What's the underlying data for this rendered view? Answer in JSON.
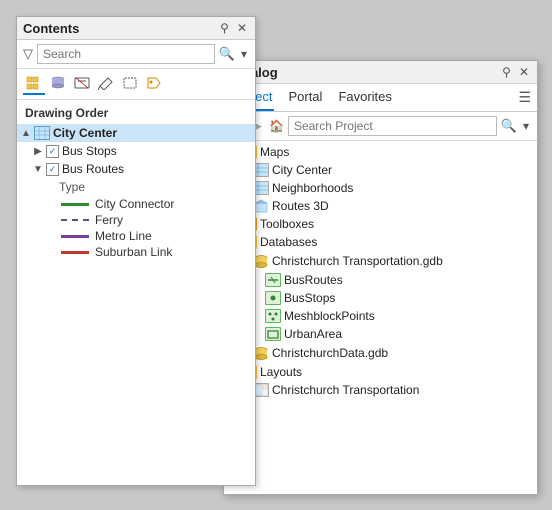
{
  "contents": {
    "title": "Contents",
    "search_placeholder": "Search",
    "section_label": "Drawing Order",
    "toolbar_icons": [
      "grid-icon",
      "cylinder-icon",
      "filter2-icon",
      "edit-icon",
      "select-icon",
      "tag-icon"
    ],
    "tree": [
      {
        "label": "City Center",
        "type": "map",
        "selected": true,
        "indent": 0,
        "expandable": true,
        "expanded": true
      },
      {
        "label": "Bus Stops",
        "type": "layer",
        "checked": true,
        "indent": 1,
        "expandable": true,
        "expanded": false
      },
      {
        "label": "Bus Routes",
        "type": "layer",
        "checked": true,
        "indent": 1,
        "expandable": true,
        "expanded": true
      }
    ],
    "legend_label": "Type",
    "legend_items": [
      {
        "label": "City Connector",
        "color": "#2e8b2e",
        "style": "solid"
      },
      {
        "label": "Ferry",
        "color": "#555577",
        "style": "dashed"
      },
      {
        "label": "Metro Line",
        "color": "#7b3f9e",
        "style": "solid"
      },
      {
        "label": "Suburban Link",
        "color": "#c0392b",
        "style": "solid"
      }
    ]
  },
  "catalog": {
    "title": "Catalog",
    "tabs": [
      "Project",
      "Portal",
      "Favorites"
    ],
    "active_tab": "Project",
    "search_placeholder": "Search Project",
    "tree": [
      {
        "label": "Maps",
        "type": "folder",
        "indent": 0,
        "expanded": true
      },
      {
        "label": "City Center",
        "type": "map",
        "indent": 1
      },
      {
        "label": "Neighborhoods",
        "type": "map",
        "indent": 1
      },
      {
        "label": "Routes 3D",
        "type": "map3d",
        "indent": 1
      },
      {
        "label": "Toolboxes",
        "type": "folder",
        "indent": 0,
        "expanded": false
      },
      {
        "label": "Databases",
        "type": "folder",
        "indent": 0,
        "expanded": true
      },
      {
        "label": "Christchurch Transportation.gdb",
        "type": "gdb",
        "indent": 1,
        "expanded": true
      },
      {
        "label": "BusRoutes",
        "type": "fc",
        "indent": 2
      },
      {
        "label": "BusStops",
        "type": "fc",
        "indent": 2
      },
      {
        "label": "MeshblockPoints",
        "type": "fc",
        "indent": 2
      },
      {
        "label": "UrbanArea",
        "type": "fc",
        "indent": 2
      },
      {
        "label": "ChristchurchData.gdb",
        "type": "gdb",
        "indent": 1,
        "expanded": false
      },
      {
        "label": "Layouts",
        "type": "folder",
        "indent": 0,
        "expanded": true
      },
      {
        "label": "Christchurch Transportation",
        "type": "layout",
        "indent": 1
      }
    ]
  }
}
